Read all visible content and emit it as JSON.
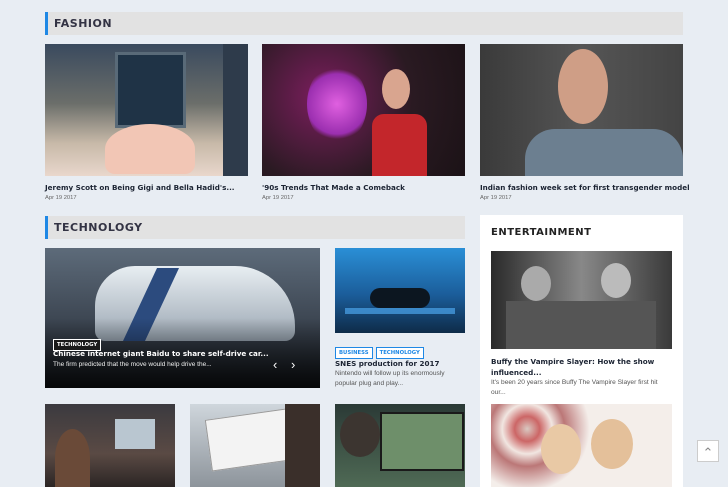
{
  "fashion": {
    "heading": "FASHION",
    "cards": [
      {
        "title": "Jeremy Scott on Being Gigi and Bella Hadid's...",
        "date": "Apr 19 2017"
      },
      {
        "title": "'90s Trends That Made a Comeback",
        "date": "Apr 19 2017"
      },
      {
        "title": "Indian fashion week set for first transgender model",
        "date": "Apr 19 2017"
      }
    ]
  },
  "technology": {
    "heading": "TECHNOLOGY",
    "featured": {
      "tag": "TECHNOLOGY",
      "title": "Chinese internet giant Baidu to share self-drive car...",
      "excerpt": "The firm predicted that the move would help drive the...",
      "prev": "‹",
      "next": "›"
    },
    "side": {
      "tags": [
        "BUSINESS",
        "TECHNOLOGY"
      ],
      "title": "SNES production for 2017",
      "excerpt": "Nintendo will follow up its enormously popular plug and play..."
    }
  },
  "entertainment": {
    "heading": "ENTERTAINMENT",
    "card": {
      "title": "Buffy the Vampire Slayer: How the show influenced...",
      "excerpt": "It's been 20 years since Buffy The Vampire Slayer first hit our..."
    }
  },
  "scroll_top": "⌃",
  "colors": {
    "accent": "#1e88e5",
    "background": "#e8edf3"
  }
}
